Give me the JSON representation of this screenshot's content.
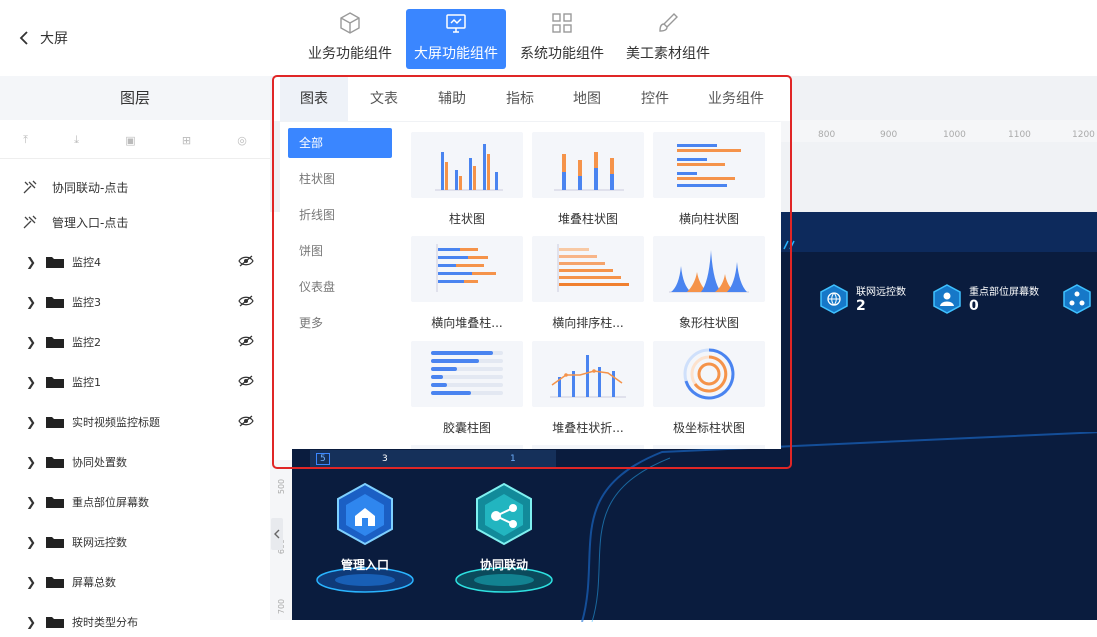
{
  "header": {
    "back_label": "大屏",
    "tabs": [
      {
        "label": "业务功能组件",
        "icon": "cube-icon"
      },
      {
        "label": "大屏功能组件",
        "icon": "monitor-icon"
      },
      {
        "label": "系统功能组件",
        "icon": "grid-icon"
      },
      {
        "label": "美工素材组件",
        "icon": "brush-icon"
      }
    ],
    "active_tab": "大屏功能组件"
  },
  "layers": {
    "title": "图层",
    "tools": [
      "⤒",
      "⤓",
      "▣",
      "⊞",
      "◎"
    ],
    "links": [
      {
        "label": "协同联动-点击"
      },
      {
        "label": "管理入口-点击"
      }
    ],
    "items": [
      {
        "label": "监控4",
        "eye": true
      },
      {
        "label": "监控3",
        "eye": true
      },
      {
        "label": "监控2",
        "eye": true
      },
      {
        "label": "监控1",
        "eye": true
      },
      {
        "label": "实时视频监控标题",
        "eye": true
      },
      {
        "label": "协同处置数",
        "eye": false
      },
      {
        "label": "重点部位屏幕数",
        "eye": false
      },
      {
        "label": "联网远控数",
        "eye": false
      },
      {
        "label": "屏幕总数",
        "eye": false
      },
      {
        "label": "按时类型分布",
        "eye": false
      }
    ]
  },
  "ruler": {
    "marks": [
      "800",
      "900",
      "1000",
      "1100",
      "1200"
    ],
    "vmarks": [
      "500",
      "600",
      "700"
    ]
  },
  "canvas": {
    "stats": [
      {
        "label": "联网远控数",
        "value": "2"
      },
      {
        "label": "重点部位屏幕数",
        "value": "0"
      }
    ],
    "nodes": [
      {
        "label": "管理入口"
      },
      {
        "label": "协同联动"
      }
    ],
    "strip_values": [
      "5",
      "3",
      "1"
    ]
  },
  "popup": {
    "tabs": [
      "图表",
      "文表",
      "辅助",
      "指标",
      "地图",
      "控件",
      "业务组件"
    ],
    "active_tab": "图表",
    "categories": [
      "全部",
      "柱状图",
      "折线图",
      "饼图",
      "仪表盘",
      "更多"
    ],
    "active_category": "全部",
    "components": [
      {
        "name": "柱状图"
      },
      {
        "name": "堆叠柱状图"
      },
      {
        "name": "横向柱状图"
      },
      {
        "name": "横向堆叠柱..."
      },
      {
        "name": "横向排序柱..."
      },
      {
        "name": "象形柱状图"
      },
      {
        "name": "胶囊柱图"
      },
      {
        "name": "堆叠柱状折..."
      },
      {
        "name": "极坐标柱状图"
      }
    ]
  },
  "colors": {
    "accent": "#3a86ff",
    "highlight": "#e02626",
    "orange": "#f5934a",
    "dark": "#0a1c3e"
  }
}
